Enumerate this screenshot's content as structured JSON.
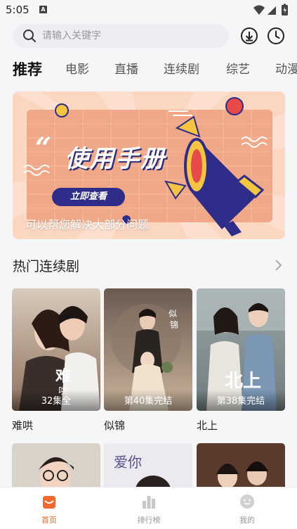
{
  "status_bar": {
    "time": "5:05",
    "notification": "A"
  },
  "search": {
    "placeholder": "请输入关键字"
  },
  "header_icons": [
    "download-icon",
    "history-clock-icon"
  ],
  "tabs": [
    {
      "label": "推荐",
      "active": true
    },
    {
      "label": "电影"
    },
    {
      "label": "直播"
    },
    {
      "label": "连续剧"
    },
    {
      "label": "综艺"
    },
    {
      "label": "动漫"
    }
  ],
  "banner": {
    "title": "使用手册",
    "button_label": "立即查看",
    "caption": "可以帮您解决大部分问题"
  },
  "section": {
    "title": "热门连续剧",
    "cards": [
      {
        "title": "难哄",
        "badge": "32集全"
      },
      {
        "title": "似锦",
        "badge": "第40集完结"
      },
      {
        "title": "北上",
        "badge": "第38集完结"
      }
    ]
  },
  "bottom_nav": [
    {
      "label": "首页",
      "icon": "home-icon",
      "active": true
    },
    {
      "label": "排行榜",
      "icon": "ranking-icon"
    },
    {
      "label": "我的",
      "icon": "profile-icon"
    }
  ],
  "colors": {
    "accent": "#ef6a2c",
    "banner_bg": "#fbd7c2",
    "banner_panel": "#f1a98a",
    "banner_navy": "#2f2d8a"
  }
}
